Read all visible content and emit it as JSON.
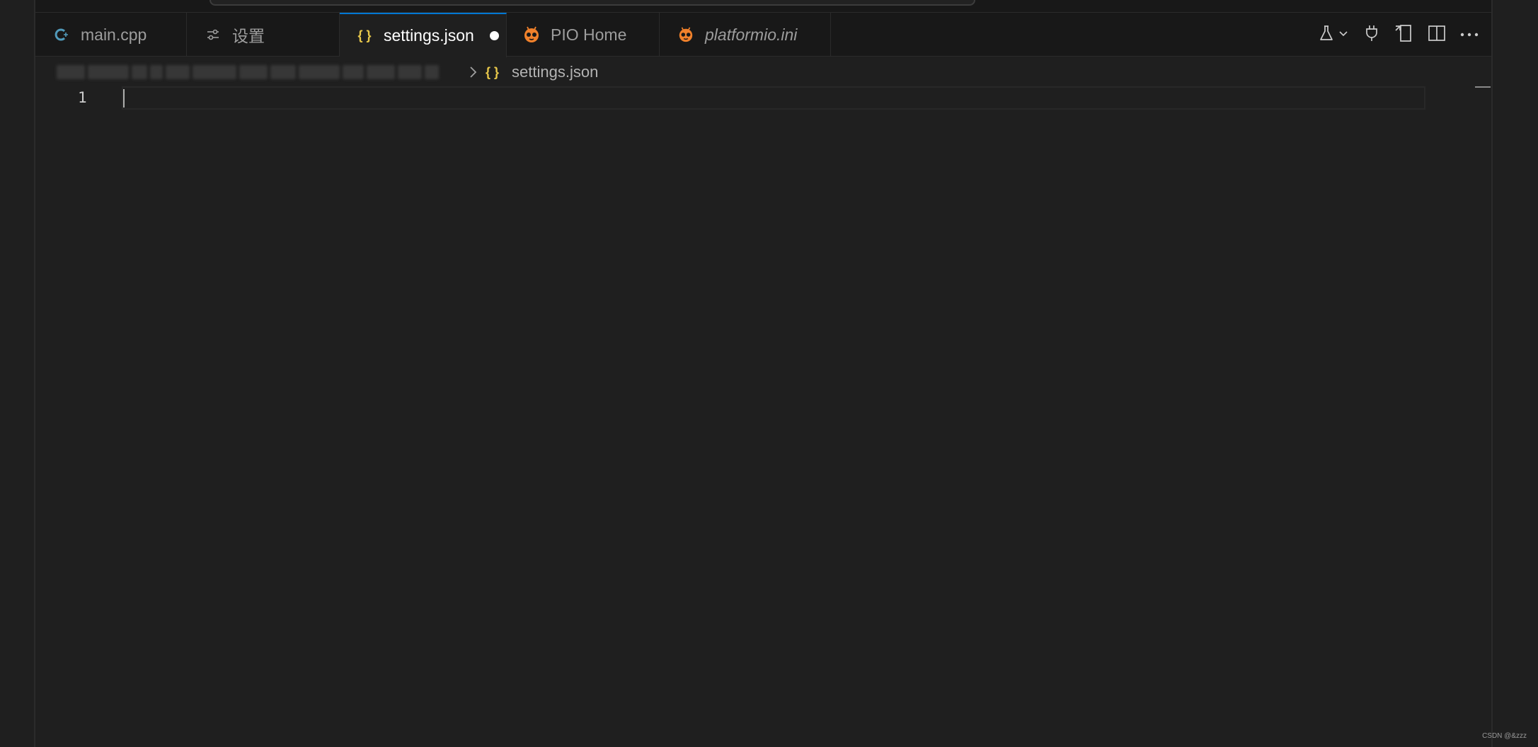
{
  "tabs": [
    {
      "label": "main.cpp",
      "icon": "cpp-file-icon",
      "active": false,
      "italic": false
    },
    {
      "label": "设置",
      "icon": "settings-sliders-icon",
      "active": false,
      "italic": false
    },
    {
      "label": "settings.json",
      "icon": "json-braces-icon",
      "active": true,
      "italic": false,
      "dirty": true
    },
    {
      "label": "PIO Home",
      "icon": "platformio-alien-icon",
      "active": false,
      "italic": false
    },
    {
      "label": "platformio.ini",
      "icon": "platformio-alien-icon",
      "active": false,
      "italic": true
    }
  ],
  "json_icon_glyph": "{ }",
  "breadcrumb": {
    "path_blurred": true,
    "file": "settings.json"
  },
  "editor": {
    "line_numbers": [
      "1"
    ],
    "content": ""
  },
  "toolbar": {
    "actions": [
      "flask-icon",
      "chevron-down-icon",
      "plug-icon",
      "open-file-icon",
      "split-editor-icon",
      "more-actions-icon"
    ]
  },
  "watermark": "CSDN @&zzz",
  "colors": {
    "accent": "#0078d4",
    "json_icon": "#e8c84a",
    "pio_orange": "#f0812b",
    "cpp_blue": "#519aba"
  }
}
